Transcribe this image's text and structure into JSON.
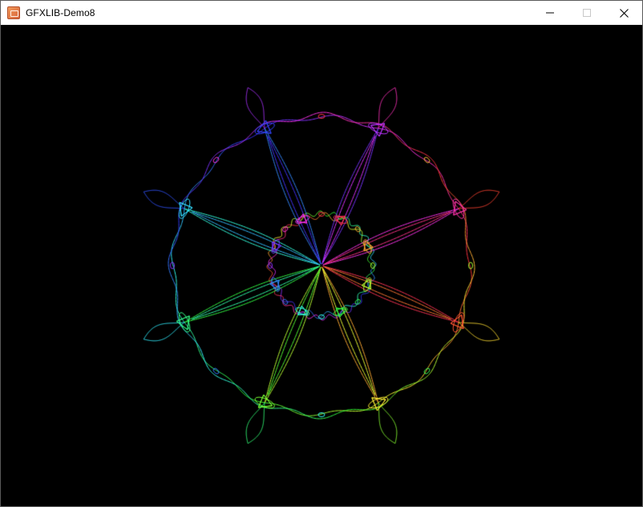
{
  "window": {
    "title": "GFXLIB-Demo8",
    "app_icon": "gfxlib-app-icon"
  },
  "controls": {
    "minimize_icon": "minimize-icon",
    "maximize_icon": "maximize-icon",
    "close_icon": "close-icon",
    "maximize_disabled": true
  },
  "canvas": {
    "background": "#000000",
    "spokes": 8,
    "render": "parametric-rosette-hsv"
  }
}
